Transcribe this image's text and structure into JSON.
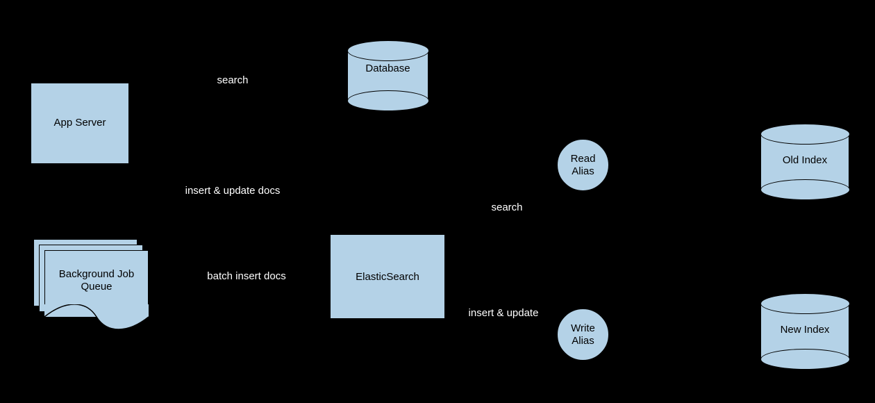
{
  "nodes": {
    "app_server": "App Server",
    "database": "Database",
    "bg_queue_line1": "Background Job",
    "bg_queue_line2": "Queue",
    "elasticsearch": "ElasticSearch",
    "read_alias_line1": "Read",
    "read_alias_line2": "Alias",
    "write_alias_line1": "Write",
    "write_alias_line2": "Alias",
    "old_index": "Old Index",
    "new_index": "New Index"
  },
  "edges": {
    "app_to_db": "search",
    "app_to_es": "insert & update docs",
    "db_to_es": "batch insert docs",
    "es_to_read": "search",
    "es_to_write": "insert & update"
  }
}
